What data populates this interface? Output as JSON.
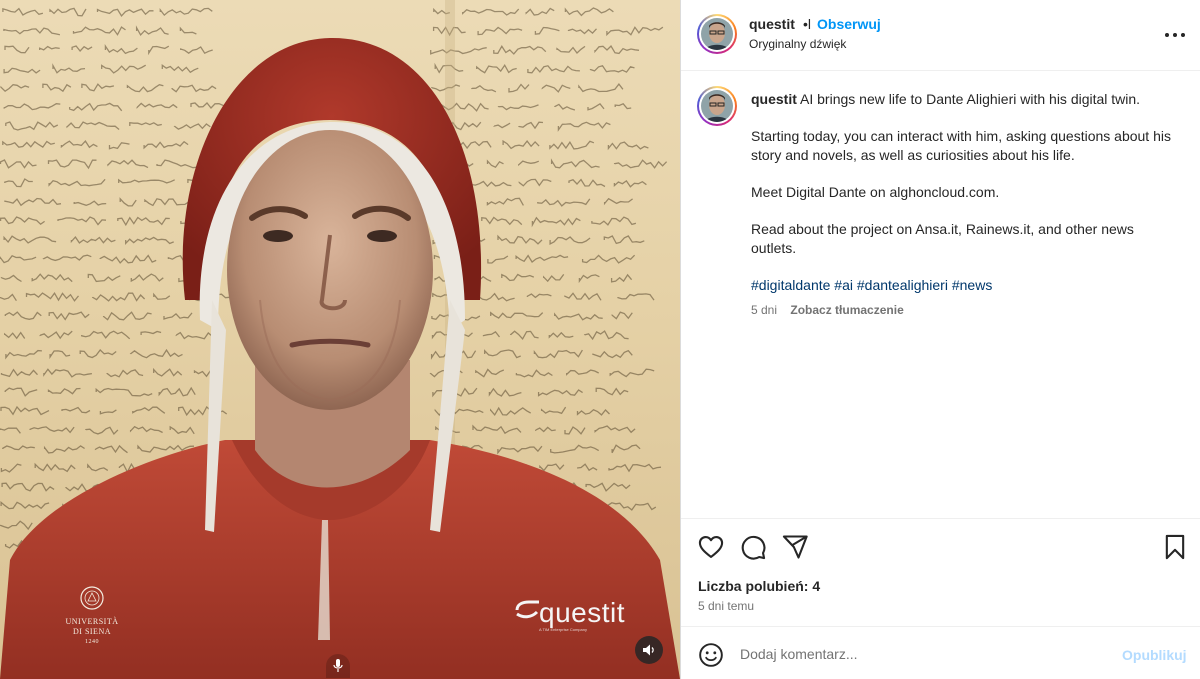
{
  "post": {
    "username": "questit",
    "verified_mark": "•l",
    "follow_label": "Obserwuj",
    "audio_label": "Oryginalny dźwięk"
  },
  "media": {
    "siena_logo_line1": "UNIVERSITÀ",
    "siena_logo_line2": "DI SIENA",
    "siena_logo_line3": "1240",
    "questit_logo": "questit",
    "questit_logo_sub": "A TIM Enterprise Company",
    "icons": [
      "audio-icon",
      "microphone-icon"
    ]
  },
  "caption": {
    "username": "questit",
    "paragraph1": "AI brings new life to Dante Alighieri with his digital twin.",
    "paragraph2": "Starting today, you can interact with him, asking questions about his story and novels, as well as curiosities about his life.",
    "paragraph3": "Meet Digital Dante on alghoncloud.com.",
    "paragraph4": "Read about the project on Ansa.it, Rainews.it, and other news outlets.",
    "hashtags": [
      "#digitaldante",
      "#ai",
      "#dantealighieri",
      "#news"
    ],
    "age": "5 dni",
    "translate_label": "Zobacz tłumaczenie"
  },
  "actions": {
    "icons": [
      "heart-icon",
      "comment-icon",
      "share-icon",
      "bookmark-icon"
    ],
    "likes_label": "Liczba polubień: 4",
    "date_label": "5 dni temu"
  },
  "comment": {
    "placeholder": "Dodaj komentarz...",
    "publish_label": "Opublikuj",
    "emoji_icon": "emoji-icon"
  },
  "colors": {
    "link_blue": "#0095f6",
    "hashtag_blue": "#00376b",
    "publish_disabled": "#b3dbff",
    "robe_red": "#b3402f",
    "parchment": "#e8d5ad"
  }
}
